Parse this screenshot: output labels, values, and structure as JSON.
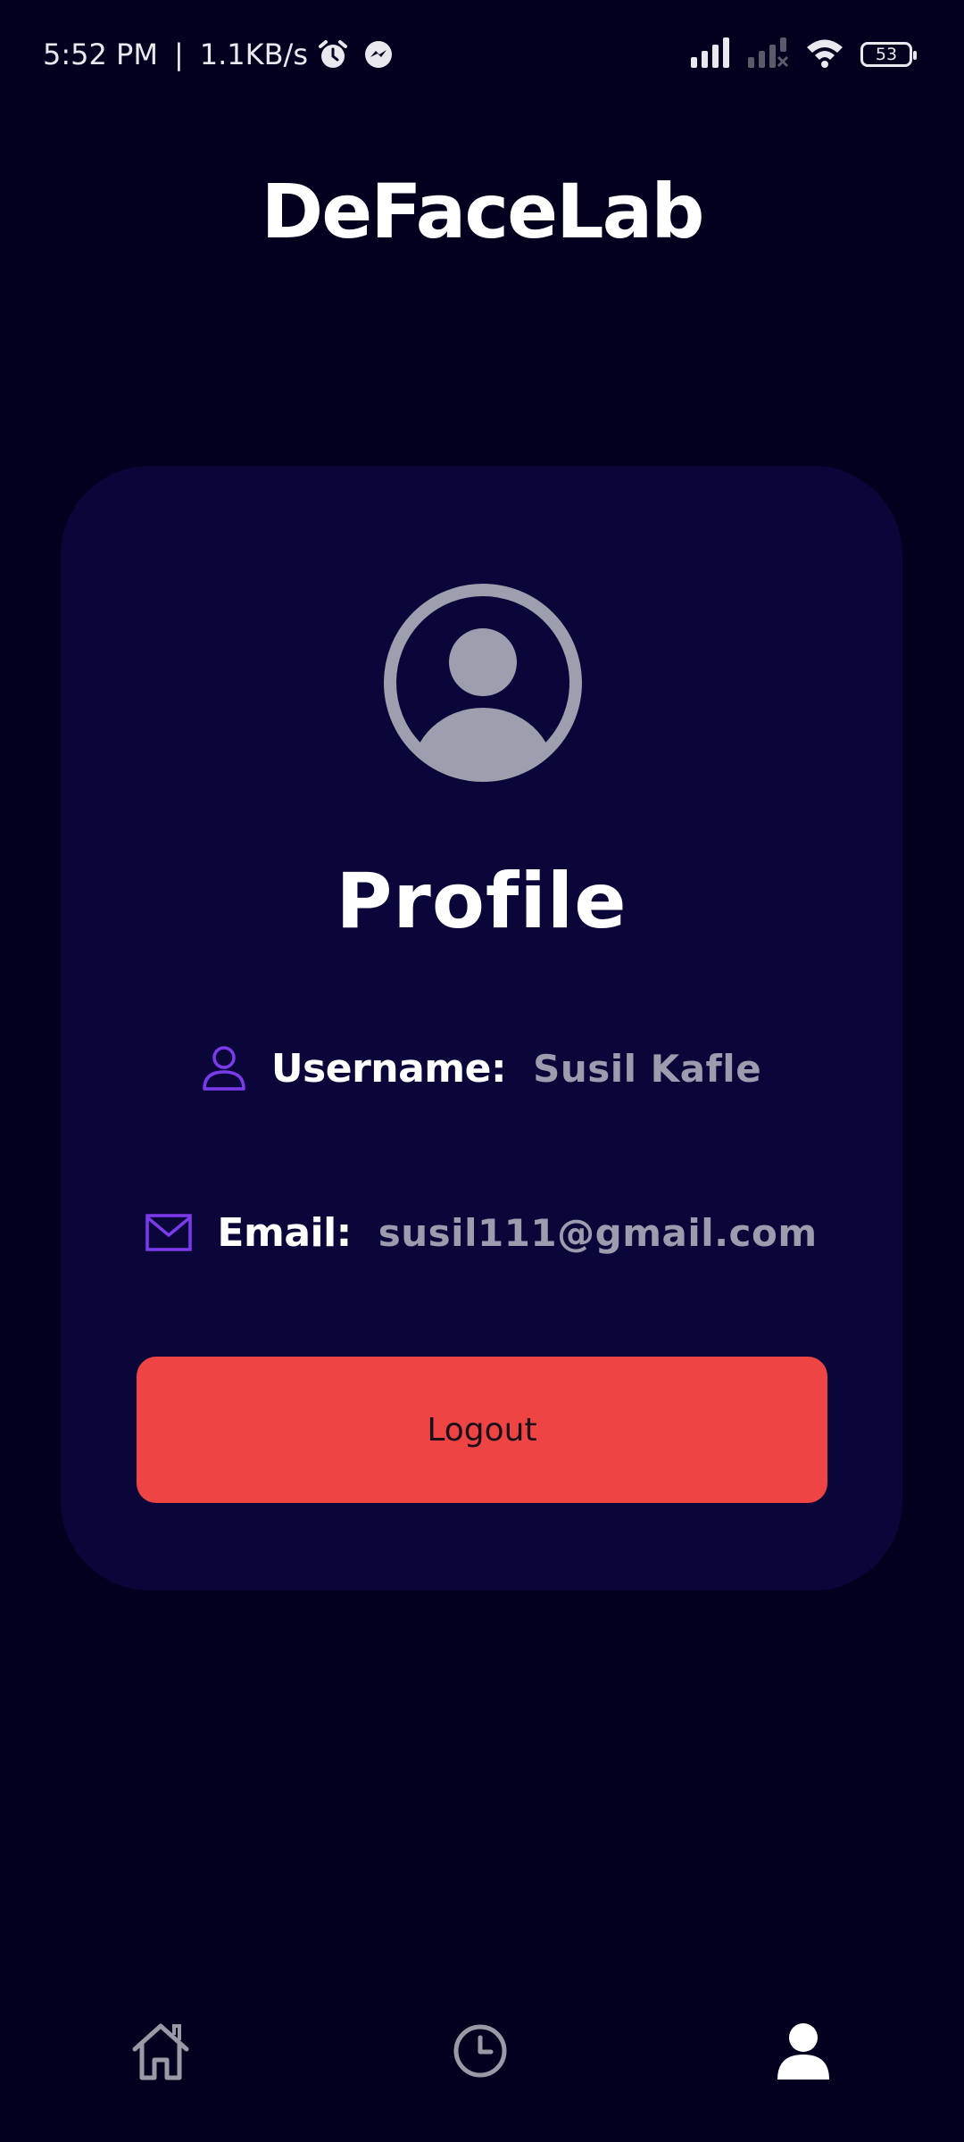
{
  "status_bar": {
    "time": "5:52 PM",
    "separator": "|",
    "network_speed": "1.1KB/s",
    "battery": "53",
    "icons": [
      "alarm-icon",
      "messenger-icon",
      "signal-icon",
      "signal-no-service-icon",
      "wifi-icon",
      "battery-icon"
    ]
  },
  "app": {
    "title": "DeFaceLab"
  },
  "profile": {
    "heading": "Profile",
    "username_label": "Username:",
    "username_value": "Susil Kafle",
    "email_label": "Email:",
    "email_value": "susil111@gmail.com",
    "logout_label": "Logout"
  },
  "nav": {
    "items": [
      {
        "icon": "home-icon",
        "active": false
      },
      {
        "icon": "history-icon",
        "active": false
      },
      {
        "icon": "profile-icon",
        "active": true
      }
    ]
  },
  "colors": {
    "background": "#03001f",
    "card": "#0a063a",
    "accent": "#7c3aed",
    "logout": "#ef4444",
    "muted_text": "#9c9cae",
    "avatar": "#9ca0ae"
  }
}
